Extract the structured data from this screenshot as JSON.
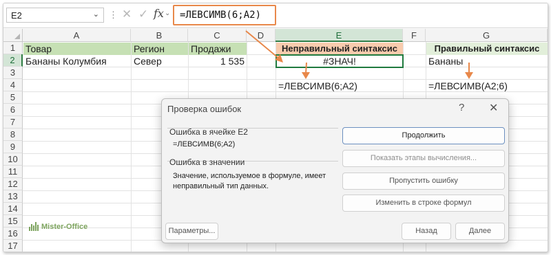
{
  "formula_bar": {
    "name_box": "E2",
    "fx_label": "fx",
    "formula": "=ЛЕВСИМВ(6;A2)"
  },
  "columns": [
    "A",
    "B",
    "C",
    "D",
    "E",
    "F",
    "G"
  ],
  "rows": [
    "1",
    "2",
    "3",
    "4",
    "5",
    "6",
    "7",
    "8",
    "9",
    "10",
    "11",
    "12",
    "13",
    "14",
    "15",
    "16",
    "17"
  ],
  "cells": {
    "a1": "Товар",
    "b1": "Регион",
    "c1": "Продажи",
    "e1": "Неправильный синтаксис",
    "g1": "Правильный синтаксис",
    "a2": "Бананы Колумбия",
    "b2": "Север",
    "c2": "1 535",
    "e2": "#ЗНАЧ!",
    "g2": "Бананы",
    "e4": "=ЛЕВСИМВ(6;A2)",
    "g4": "=ЛЕВСИМВ(A2;6)"
  },
  "dialog": {
    "title": "Проверка ошибок",
    "help": "?",
    "close": "✕",
    "error_in_cell_label": "Ошибка в ячейке E2",
    "error_formula": "=ЛЕВСИМВ(6;A2)",
    "error_type_label": "Ошибка в значении",
    "error_description": "Значение, используемое в формуле, имеет неправильный тип данных.",
    "buttons": {
      "continue": "Продолжить",
      "show_steps": "Показать этапы вычисления...",
      "ignore": "Пропустить ошибку",
      "edit_in_bar": "Изменить в строке формул",
      "options": "Параметры...",
      "back": "Назад",
      "next": "Далее"
    }
  },
  "watermark": "Mister-Office",
  "colors": {
    "accent_orange": "#e8884a",
    "header_green": "#c6e0b4",
    "header_red": "#f8cbad",
    "selection_green": "#1f7a3e"
  }
}
